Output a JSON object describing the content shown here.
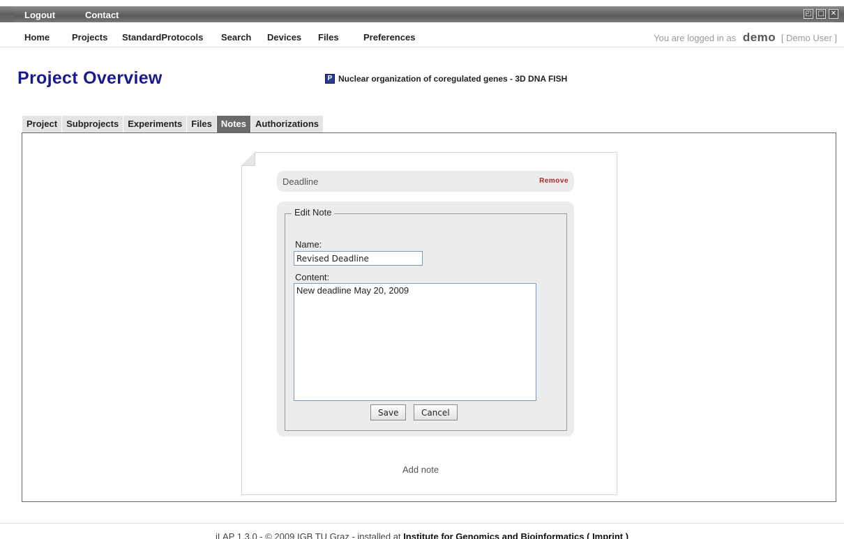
{
  "topbar": {
    "logout_label": "Logout",
    "contact_label": "Contact"
  },
  "window_controls": {
    "restore": "◰",
    "maximize": "□",
    "close": "✕"
  },
  "nav": {
    "items": [
      {
        "label": "Home"
      },
      {
        "label": "Projects"
      },
      {
        "label": "StandardProtocols"
      },
      {
        "label": "Search"
      },
      {
        "label": "Devices"
      },
      {
        "label": "Files"
      },
      {
        "label": "Preferences"
      }
    ],
    "logged_in_prefix": "You are logged in as",
    "username": "demo",
    "fullname": "[ Demo User ]"
  },
  "page": {
    "title": "Project Overview",
    "project_icon": "P",
    "project_name": "Nuclear organization of coregulated genes - 3D DNA FISH"
  },
  "tabs": [
    {
      "label": "Project",
      "active": false
    },
    {
      "label": "Subprojects",
      "active": false
    },
    {
      "label": "Experiments",
      "active": false
    },
    {
      "label": "Files",
      "active": false
    },
    {
      "label": "Notes",
      "active": true
    },
    {
      "label": "Authorizations",
      "active": false
    }
  ],
  "note": {
    "name": "Deadline",
    "remove_label": "Remove",
    "edit_legend": "Edit Note",
    "name_label": "Name:",
    "name_value": "Revised Deadline",
    "content_label": "Content:",
    "content_value": "New deadline May 20, 2009",
    "save_label": "Save",
    "cancel_label": "Cancel"
  },
  "add_note_label": "Add note",
  "footer": {
    "prefix": "iLAP 1.3.0 - © 2009 IGB TU Graz - installed at",
    "institute": "Institute for Genomics and Bioinformatics",
    "imprint": "( Imprint )"
  },
  "colors": {
    "title": "#1a1a8c",
    "active_tab": "#6a6a6a",
    "remove": "#b22222"
  }
}
